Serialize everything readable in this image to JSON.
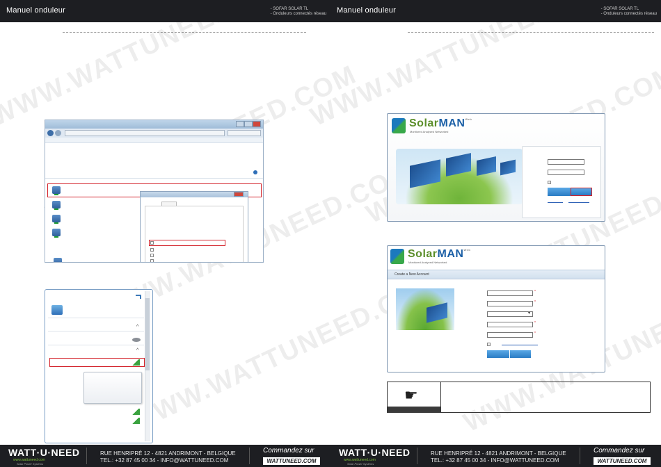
{
  "header": {
    "title": "Manuel onduleur",
    "meta_line1": "- SOFAR SOLAR TL",
    "meta_line2": "- Onduleurs connectés réseau"
  },
  "watermark": "WWW.WATTUNEED.COM",
  "screenshot_network": {
    "description_icons": [
      "network-adapter-icon",
      "network-adapter-icon",
      "network-adapter-icon",
      "network-adapter-icon"
    ]
  },
  "solarman_login": {
    "brand_solar": "Solar",
    "brand_man": "MAN",
    "brand_web": "Web",
    "tagline": "Monitored  Analyzed  Networked"
  },
  "solarman_register": {
    "brand_solar": "Solar",
    "brand_man": "MAN",
    "brand_web": "Web",
    "tagline": "Monitored  Analyzed  Networked",
    "heading": "Create a New Account"
  },
  "footer": {
    "brand": "WATT·U·NEED",
    "brand_sub": "www.wattuneed.com",
    "brand_slogan": "Solar Power Systems",
    "address_line1": "RUE HENRIPRÉ 12 - 4821 ANDRIMONT - BELGIQUE",
    "address_line2": "TEL.: +32 87 45 00 34 - INFO@WATTUNEED.COM",
    "cta": "Commandez sur",
    "url": "WATTUNEED.COM"
  },
  "colors": {
    "header_bg": "#1d1e22",
    "highlight_red": "#d3222a",
    "brand_green": "#7fbf3a"
  }
}
